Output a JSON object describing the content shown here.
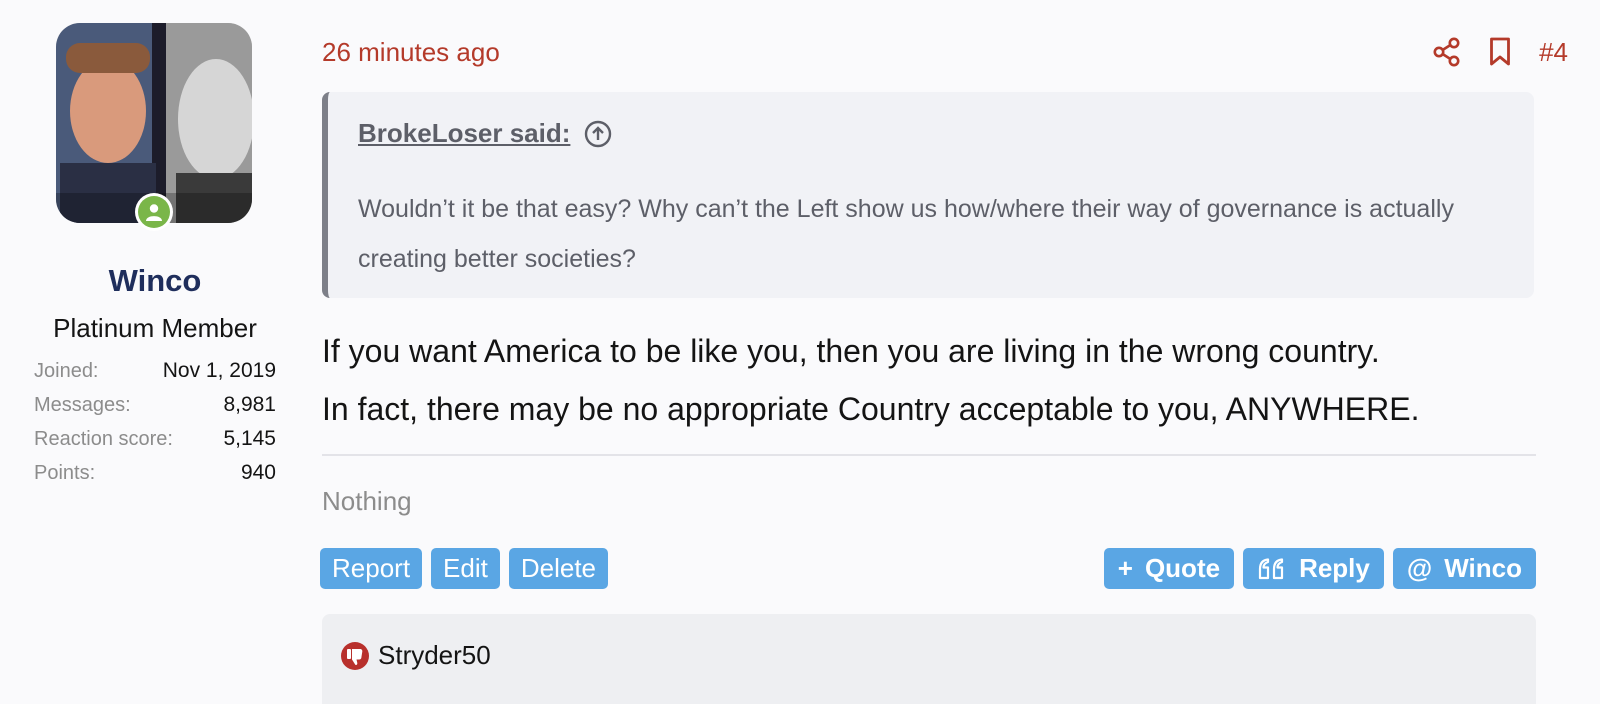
{
  "user": {
    "name": "Winco",
    "title": "Platinum Member",
    "stats": [
      {
        "label": "Joined:",
        "value": "Nov 1, 2019"
      },
      {
        "label": "Messages:",
        "value": "8,981"
      },
      {
        "label": "Reaction score:",
        "value": "5,145"
      },
      {
        "label": "Points:",
        "value": "940"
      }
    ],
    "avatar_icon": "avatar-image",
    "online_status": "online"
  },
  "post": {
    "time": "26 minutes ago",
    "number": "#4",
    "icons": {
      "share": "share-icon",
      "bookmark": "bookmark-icon"
    }
  },
  "quote": {
    "author": "BrokeLoser said:",
    "body": "Wouldn’t it be that easy? Why can’t the Left show us how/where their way of governance is actually creating better societies?"
  },
  "message": {
    "lines": [
      "If you want America to be like you, then you are living in the wrong country.",
      "In fact, there may be no appropriate Country acceptable to you, ANYWHERE."
    ]
  },
  "signature": "Nothing",
  "actions_left": {
    "report": "Report",
    "edit": "Edit",
    "delete": "Delete"
  },
  "actions_right": {
    "quote": {
      "icon": "+",
      "label": "Quote"
    },
    "reply": {
      "label": "Reply"
    },
    "mention": {
      "icon": "@",
      "label": "Winco"
    }
  },
  "reactions": {
    "user": "Stryder50",
    "type": "dislike"
  },
  "colors": {
    "accent_red": "#b43a2a",
    "button_blue": "#5aa6e4",
    "username_navy": "#1f2e5c",
    "online_green": "#7ab649"
  }
}
